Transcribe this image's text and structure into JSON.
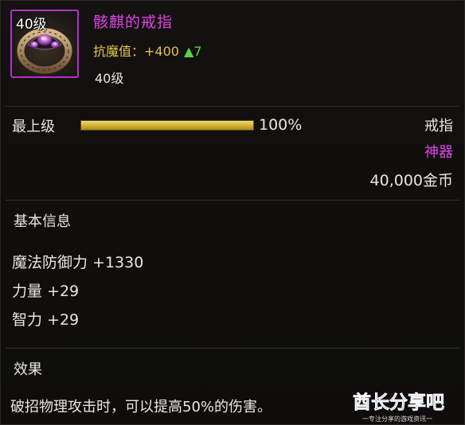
{
  "item": {
    "icon": "ring-icon",
    "icon_level": "40级",
    "name": "骸麒的戒指",
    "stat_label": "抗魔值：",
    "stat_value": "+400",
    "stat_up": "▲7",
    "required_level": "40级"
  },
  "upgrade": {
    "label": "最上级",
    "progress": 1.0,
    "progress_text": "100%"
  },
  "meta": {
    "type": "戒指",
    "rarity": "神器",
    "price": "40,000金币"
  },
  "basic_info": {
    "title": "基本信息",
    "attributes": [
      "魔法防御力 +1330",
      "力量 +29",
      "智力 +29"
    ]
  },
  "effect": {
    "title": "效果",
    "text": "破招物理攻击时，可以提高50%的伤害。"
  },
  "watermark": {
    "title": "酋长分享吧",
    "subtitle": "一专注分享的游戏资讯一"
  },
  "colors": {
    "epic_purple": "#e042e8",
    "gold": "#e3c34a",
    "up_green": "#5bd24a",
    "watermark_blue": "#1d6fd6"
  }
}
